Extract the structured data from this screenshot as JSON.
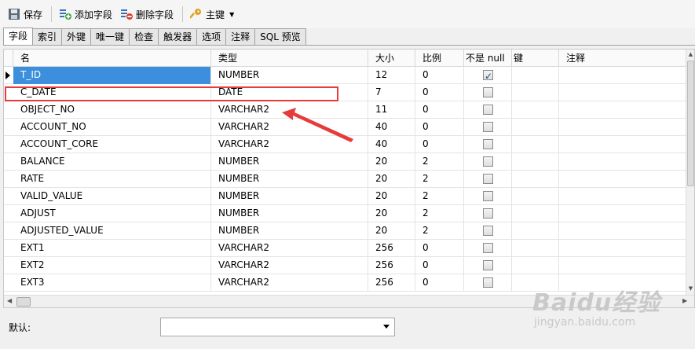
{
  "toolbar": {
    "save": "保存",
    "add_field": "添加字段",
    "delete_field": "删除字段",
    "primary_key": "主键"
  },
  "tabs": [
    "字段",
    "索引",
    "外键",
    "唯一键",
    "检查",
    "触发器",
    "选项",
    "注释",
    "SQL 预览"
  ],
  "columns": [
    "名",
    "类型",
    "大小",
    "比例",
    "不是 null",
    "键",
    "注释"
  ],
  "rows": [
    {
      "name": "T_ID",
      "type": "NUMBER",
      "size": "12",
      "scale": "0",
      "not_null": true
    },
    {
      "name": "C_DATE",
      "type": "DATE",
      "size": "7",
      "scale": "0",
      "not_null": false
    },
    {
      "name": "OBJECT_NO",
      "type": "VARCHAR2",
      "size": "11",
      "scale": "0",
      "not_null": false
    },
    {
      "name": "ACCOUNT_NO",
      "type": "VARCHAR2",
      "size": "40",
      "scale": "0",
      "not_null": false
    },
    {
      "name": "ACCOUNT_CORE",
      "type": "VARCHAR2",
      "size": "40",
      "scale": "0",
      "not_null": false
    },
    {
      "name": "BALANCE",
      "type": "NUMBER",
      "size": "20",
      "scale": "2",
      "not_null": false
    },
    {
      "name": "RATE",
      "type": "NUMBER",
      "size": "20",
      "scale": "2",
      "not_null": false
    },
    {
      "name": "VALID_VALUE",
      "type": "NUMBER",
      "size": "20",
      "scale": "2",
      "not_null": false
    },
    {
      "name": "ADJUST",
      "type": "NUMBER",
      "size": "20",
      "scale": "2",
      "not_null": false
    },
    {
      "name": "ADJUSTED_VALUE",
      "type": "NUMBER",
      "size": "20",
      "scale": "2",
      "not_null": false
    },
    {
      "name": "EXT1",
      "type": "VARCHAR2",
      "size": "256",
      "scale": "0",
      "not_null": false
    },
    {
      "name": "EXT2",
      "type": "VARCHAR2",
      "size": "256",
      "scale": "0",
      "not_null": false
    },
    {
      "name": "EXT3",
      "type": "VARCHAR2",
      "size": "256",
      "scale": "0",
      "not_null": false
    }
  ],
  "bottom": {
    "default_label": "默认:",
    "default_value": ""
  },
  "watermark": {
    "main": "Baidu经验",
    "url": "jingyan.baidu.com"
  },
  "colors": {
    "selection": "#3c8fdc",
    "highlight_annotation": "#e63b3b"
  }
}
